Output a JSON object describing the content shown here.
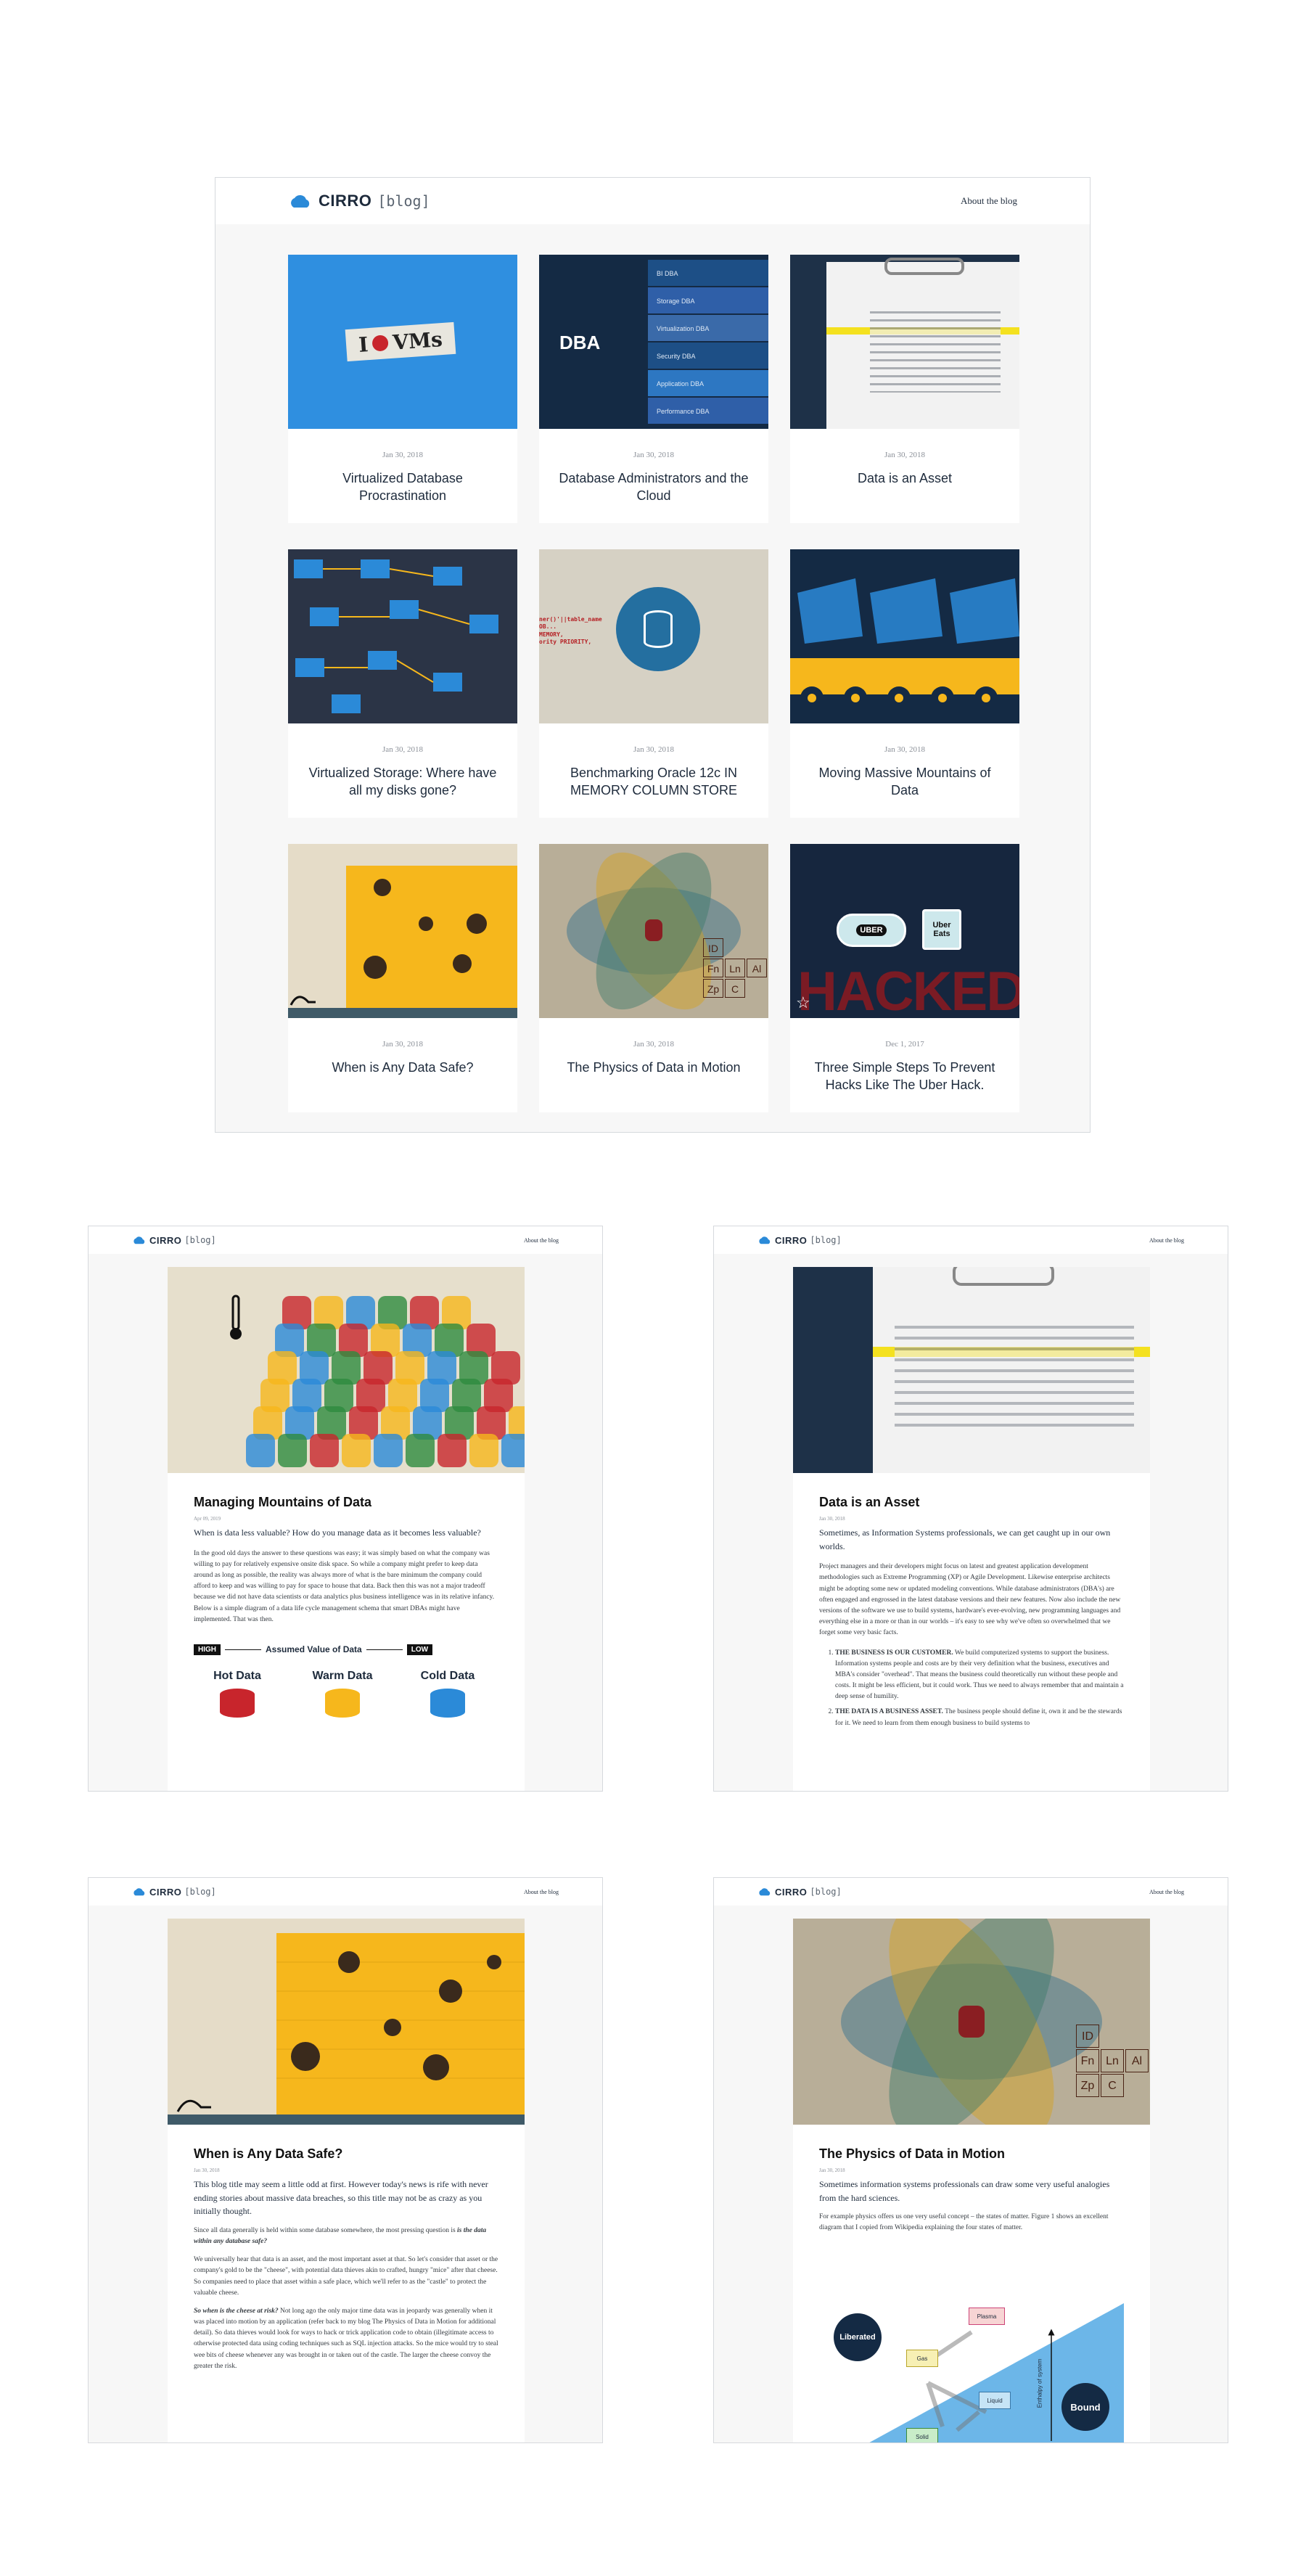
{
  "brand": {
    "name": "CIRRO",
    "suffix": "[blog]",
    "about": "About the blog",
    "color": "#2b8ad8"
  },
  "cards": [
    {
      "date": "Jan 30, 2018",
      "title": "Virtualized Database Procrastination",
      "art_text": "VMs"
    },
    {
      "date": "Jan 30, 2018",
      "title": "Database Administrators and the Cloud",
      "art_text": "DBA",
      "menu": [
        "BI DBA",
        "Storage DBA",
        "Virtualization DBA",
        "Security DBA",
        "Application DBA",
        "Performance DBA"
      ]
    },
    {
      "date": "Jan 30, 2018",
      "title": "Data is an Asset"
    },
    {
      "date": "Jan 30, 2018",
      "title": "Virtualized Storage: Where have all my disks gone?"
    },
    {
      "date": "Jan 30, 2018",
      "title": "Benchmarking Oracle 12c IN MEMORY COLUMN STORE",
      "art_text": "ner()'||table_name OB...\nMEMORY,\nority PRIORITY,"
    },
    {
      "date": "Jan 30, 2018",
      "title": "Moving Massive Mountains of Data"
    },
    {
      "date": "Jan 30, 2018",
      "title": "When is Any Data Safe?"
    },
    {
      "date": "Jan 30, 2018",
      "title": "The Physics of Data in Motion",
      "elements": [
        "ID",
        "Fn",
        "Ln",
        "Al",
        "Zp",
        "C"
      ]
    },
    {
      "date": "Dec 1, 2017",
      "title": "Three Simple Steps To Prevent Hacks Like The Uber Hack.",
      "art_text": "HACKED",
      "uber": "UBER",
      "uber_eats": "Uber Eats"
    }
  ],
  "article1": {
    "title": "Managing Mountains of Data",
    "date": "Apr 09, 2019",
    "lede": "When is data less valuable? How do you manage data as it becomes less valuable?",
    "body": "In the good old days the answer to these questions was easy; it was simply based on what the company was willing to pay for relatively expensive onsite disk space. So while a company might prefer to keep data around as long as possible, the reality was always more of what is the bare minimum the company could afford to keep and was willing to pay for space to house that data. Back then this was not a major tradeoff because we did not have data scientists or data analytics plus business intelligence was in its relative infancy. Below is a simple diagram of a data life cycle management schema that smart DBAs might have implemented. That was then.",
    "diagram": {
      "high": "HIGH",
      "label": "Assumed Value of Data",
      "low": "LOW",
      "tiers": [
        "Hot Data",
        "Warm Data",
        "Cold Data"
      ]
    }
  },
  "article2": {
    "title": "Data is an Asset",
    "date": "Jan 30, 2018",
    "lede": "Sometimes, as Information Systems professionals, we can get caught up in our own worlds.",
    "body": "Project managers and their developers might focus on latest and greatest application development methodologies such as Extreme Programming (XP) or Agile Development. Likewise enterprise architects might be adopting some new or updated modeling conventions. While database administrators (DBA's) are often engaged and engrossed in the latest database versions and their new features. Now also include the new versions of the software we use to build systems, hardware's ever-evolving, new programming languages and everything else in a more or than in our worlds – it's easy to see why we've often so overwhelmed that we forget some very basic facts.",
    "items": [
      {
        "lead": "THE BUSINESS IS OUR CUSTOMER.",
        "text": " We build computerized systems to support the business. Information systems people and costs are by their very definition what the business, executives and MBA's consider \"overhead\". That means the business could theoretically run without these people and costs. It might be less efficient, but it could work. Thus we need to always remember that and maintain a deep sense of humility."
      },
      {
        "lead": "THE DATA IS A BUSINESS ASSET.",
        "text": " The business people should define it, own it and be the stewards for it. We need to learn from them enough business to build systems to"
      }
    ]
  },
  "article3": {
    "title": "When is Any Data Safe?",
    "date": "Jan 30, 2018",
    "lede": "This blog title may seem a little odd at first. However today's news is rife with never ending stories about massive data breaches, so this title may not be as crazy as you initially thought.",
    "p1a": "Since all data generally is held within some database somewhere, the most pressing question is ",
    "p1b": "is the data within any database safe?",
    "p2": "We universally hear that data is an asset, and the most important asset at that. So let's consider that asset or the company's gold to be the \"cheese\", with potential data thieves akin to crafted, hungry \"mice\" after that cheese. So companies need to place that asset within a safe place, which we'll refer to as the \"castle\" to protect the valuable cheese.",
    "p3a": "So when is the cheese at risk?",
    "p3b": " Not long ago the only major time data was in jeopardy was generally when it was placed into motion by an application (refer back to my blog The Physics of Data in Motion for additional detail). So data thieves would look for ways to hack or trick application code to obtain (illegitimate access to otherwise protected data using coding techniques such as SQL injection attacks. So the mice would try to steal wee bits of cheese whenever any was brought in or taken out of the castle. The larger the cheese convoy the greater the risk."
  },
  "article4": {
    "title": "The Physics of Data in Motion",
    "date": "Jan 30, 2018",
    "lede": "Sometimes information systems professionals can draw some very useful analogies from the hard sciences.",
    "body": "For example physics offers us one very useful concept – the states of matter. Figure 1 shows an excellent diagram that I copied from Wikipedia explaining the four states of matter.",
    "diagram": {
      "liberated": "Liberated",
      "bound": "Bound",
      "plasma": "Plasma",
      "gas": "Gas",
      "liquid": "Liquid",
      "solid": "Solid",
      "axis": "Enthalpy of system"
    }
  },
  "colors": {
    "blue": "#2b8ad8",
    "navy": "#142a44",
    "yellow": "#f6b71c",
    "red": "#c8252c",
    "teal": "#2f6e8f"
  }
}
